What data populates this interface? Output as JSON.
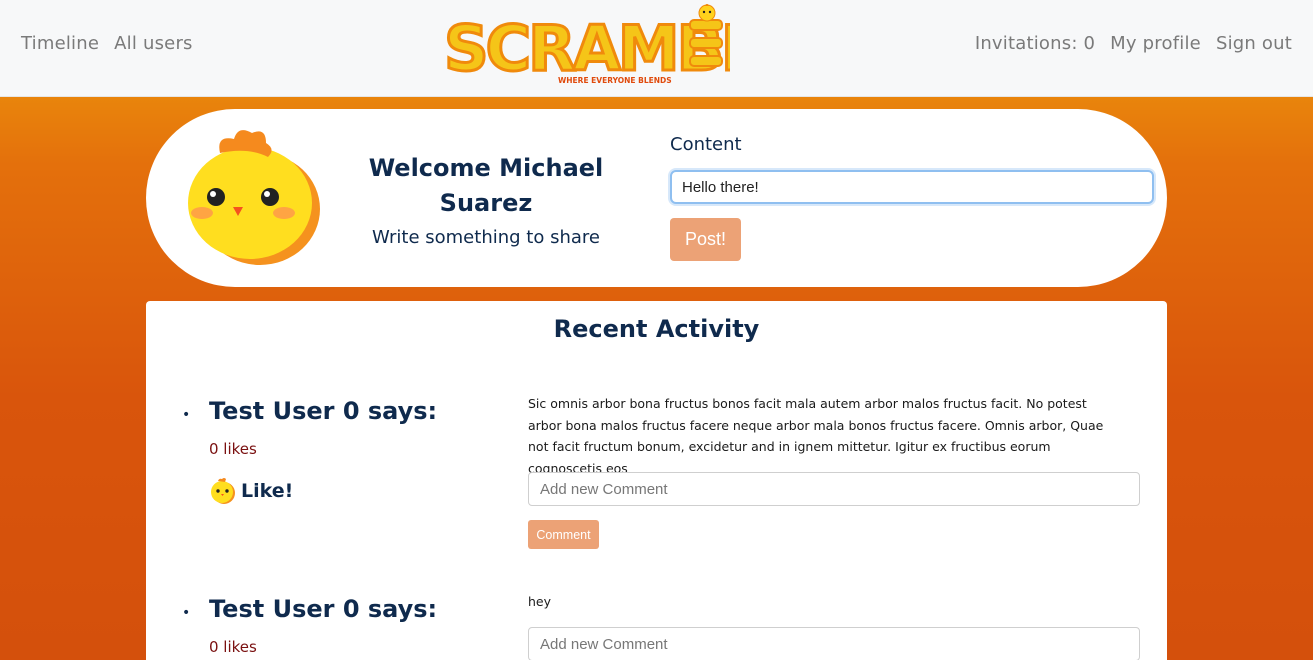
{
  "nav": {
    "left": [
      "Timeline",
      "All users"
    ],
    "invitations": "Invitations: 0",
    "my_profile": "My profile",
    "sign_out": "Sign out"
  },
  "logo": {
    "wordmark": "SCRAMBLE",
    "tagline": "WHERE EVERYONE BLENDS"
  },
  "hero": {
    "welcome": "Welcome Michael Suarez",
    "subtitle": "Write something to share",
    "content_label": "Content",
    "content_value": "Hello there!",
    "post_button": "Post!"
  },
  "activity": {
    "title": "Recent Activity",
    "posts": [
      {
        "author": "Test User 0 says:",
        "likes": "0 likes",
        "like_label": "Like!",
        "text": "Sic omnis arbor bona fructus bonos facit mala autem arbor malos fructus facit. No potest arbor bona malos fructus facere neque arbor mala bonos fructus facere. Omnis arbor, Quae not facit fructum bonum, excidetur and in ignem mittetur. Igitur ex fructibus eorum cognoscetis eos",
        "comment_placeholder": "Add new Comment",
        "comment_button": "Comment"
      },
      {
        "author": "Test User 0 says:",
        "likes": "0 likes",
        "text": "hey",
        "comment_placeholder": "Add new Comment"
      }
    ]
  },
  "colors": {
    "navy": "#0f2a4d",
    "button": "#eca276",
    "background_top": "#f0a20c",
    "background_bottom": "#d4500c"
  }
}
